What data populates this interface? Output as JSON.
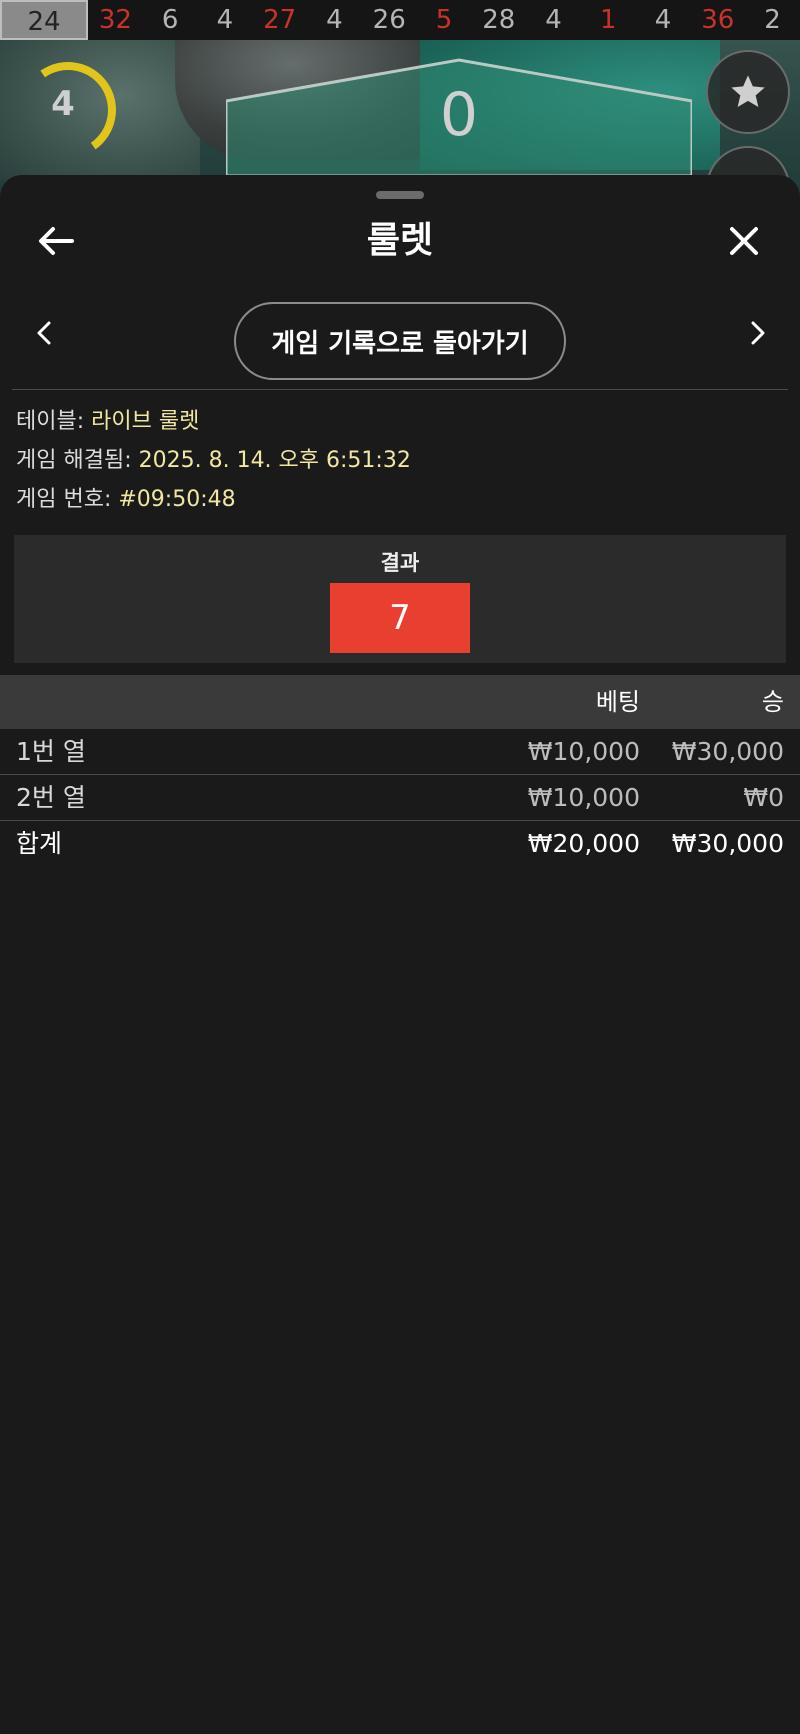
{
  "history_strip": [
    {
      "value": "24",
      "color": "current"
    },
    {
      "value": "32",
      "color": "red"
    },
    {
      "value": "6",
      "color": "black"
    },
    {
      "value": "4",
      "color": "black"
    },
    {
      "value": "27",
      "color": "red"
    },
    {
      "value": "4",
      "color": "black"
    },
    {
      "value": "26",
      "color": "black"
    },
    {
      "value": "5",
      "color": "red"
    },
    {
      "value": "28",
      "color": "black"
    },
    {
      "value": "4",
      "color": "black"
    },
    {
      "value": "1",
      "color": "red"
    },
    {
      "value": "4",
      "color": "black"
    },
    {
      "value": "36",
      "color": "red"
    },
    {
      "value": "2",
      "color": "black"
    }
  ],
  "timer": {
    "value": "4"
  },
  "table_zero": "0",
  "icons": {
    "favorite": "star-icon",
    "back": "arrow-left-icon",
    "close": "close-icon",
    "prev": "chevron-left-icon",
    "next": "chevron-right-icon"
  },
  "sheet": {
    "title": "룰렛",
    "history_back_label": "게임 기록으로 돌아가기"
  },
  "info": {
    "table_label": "테이블: ",
    "table_value": "라이브 룰렛",
    "settled_label": "게임 해결됨: ",
    "settled_value": "2025. 8. 14. 오후 6:51:32",
    "number_label": "게임 번호: ",
    "number_value": "#09:50:48"
  },
  "result": {
    "label": "결과",
    "number": "7",
    "color": "#e83f30"
  },
  "bets": {
    "header": {
      "bet": "베팅",
      "win": "승"
    },
    "rows": [
      {
        "label": "1번 열",
        "bet": "₩10,000",
        "win": "₩30,000"
      },
      {
        "label": "2번 열",
        "bet": "₩10,000",
        "win": "₩0"
      }
    ],
    "total": {
      "label": "합계",
      "bet": "₩20,000",
      "win": "₩30,000"
    }
  },
  "colors": {
    "accent_highlight": "#f1e6a4",
    "sheet_bg": "#1a1a1a",
    "timer": "#e2c51a",
    "red": "#c9322a"
  }
}
